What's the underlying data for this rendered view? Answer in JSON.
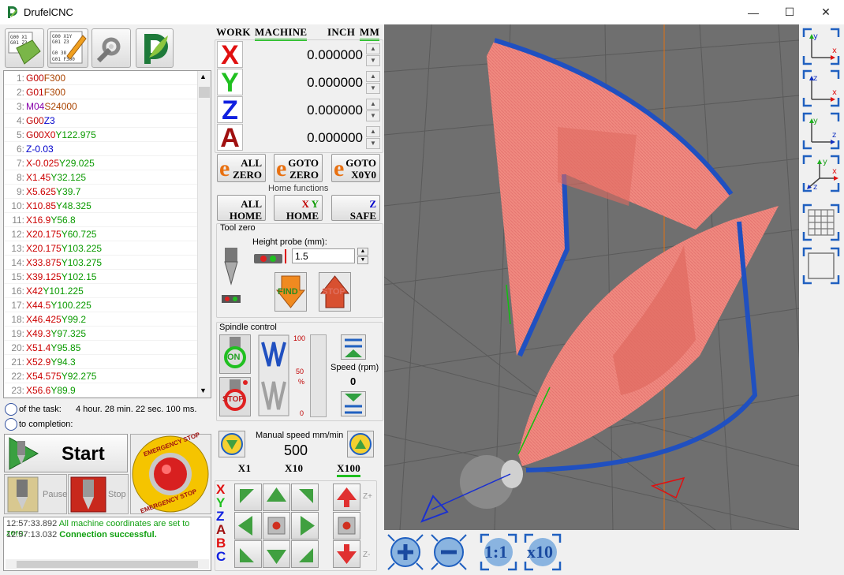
{
  "app": {
    "title": "DrufelCNC"
  },
  "window": {
    "minimize": "—",
    "maximize": "☐",
    "close": "✕"
  },
  "code_lines": [
    {
      "n": "1:",
      "parts": [
        [
          "G00",
          "cg"
        ],
        [
          "F300",
          "cf"
        ]
      ]
    },
    {
      "n": "2:",
      "parts": [
        [
          "G01",
          "cg"
        ],
        [
          "F300",
          "cf"
        ]
      ]
    },
    {
      "n": "3:",
      "parts": [
        [
          "M04",
          "cm"
        ],
        [
          "S24000",
          "cs"
        ]
      ]
    },
    {
      "n": "4:",
      "parts": [
        [
          "G00",
          "cg"
        ],
        [
          "Z3",
          "cz"
        ]
      ]
    },
    {
      "n": "5:",
      "parts": [
        [
          "G00",
          "cg"
        ],
        [
          "X0",
          "cx"
        ],
        [
          "Y122.975",
          "cy"
        ]
      ]
    },
    {
      "n": "6:",
      "parts": [
        [
          "Z-0.03",
          "cz"
        ]
      ]
    },
    {
      "n": "7:",
      "parts": [
        [
          "X-0.025",
          "cx"
        ],
        [
          "Y29.025",
          "cy"
        ]
      ]
    },
    {
      "n": "8:",
      "parts": [
        [
          "X1.45",
          "cx"
        ],
        [
          "Y32.125",
          "cy"
        ]
      ]
    },
    {
      "n": "9:",
      "parts": [
        [
          "X5.625",
          "cx"
        ],
        [
          "Y39.7",
          "cy"
        ]
      ]
    },
    {
      "n": "10:",
      "parts": [
        [
          "X10.85",
          "cx"
        ],
        [
          "Y48.325",
          "cy"
        ]
      ]
    },
    {
      "n": "11:",
      "parts": [
        [
          "X16.9",
          "cx"
        ],
        [
          "Y56.8",
          "cy"
        ]
      ]
    },
    {
      "n": "12:",
      "parts": [
        [
          "X20.175",
          "cx"
        ],
        [
          "Y60.725",
          "cy"
        ]
      ]
    },
    {
      "n": "13:",
      "parts": [
        [
          "X20.175",
          "cx"
        ],
        [
          "Y103.225",
          "cy"
        ]
      ]
    },
    {
      "n": "14:",
      "parts": [
        [
          "X33.875",
          "cx"
        ],
        [
          "Y103.275",
          "cy"
        ]
      ]
    },
    {
      "n": "15:",
      "parts": [
        [
          "X39.125",
          "cx"
        ],
        [
          "Y102.15",
          "cy"
        ]
      ]
    },
    {
      "n": "16:",
      "parts": [
        [
          "X42",
          "cx"
        ],
        [
          "Y101.225",
          "cy"
        ]
      ]
    },
    {
      "n": "17:",
      "parts": [
        [
          "X44.5",
          "cx"
        ],
        [
          "Y100.225",
          "cy"
        ]
      ]
    },
    {
      "n": "18:",
      "parts": [
        [
          "X46.425",
          "cx"
        ],
        [
          "Y99.2",
          "cy"
        ]
      ]
    },
    {
      "n": "19:",
      "parts": [
        [
          "X49.3",
          "cx"
        ],
        [
          "Y97.325",
          "cy"
        ]
      ]
    },
    {
      "n": "20:",
      "parts": [
        [
          "X51.4",
          "cx"
        ],
        [
          "Y95.85",
          "cy"
        ]
      ]
    },
    {
      "n": "21:",
      "parts": [
        [
          "X52.9",
          "cx"
        ],
        [
          "Y94.3",
          "cy"
        ]
      ]
    },
    {
      "n": "22:",
      "parts": [
        [
          "X54.575",
          "cx"
        ],
        [
          "Y92.275",
          "cy"
        ]
      ]
    },
    {
      "n": "23:",
      "parts": [
        [
          "X56.6",
          "cx"
        ],
        [
          "Y89.9",
          "cy"
        ]
      ]
    }
  ],
  "status": {
    "task_label": "of the task:",
    "task_time": "4 hour. 28 min. 22 sec. 100 ms.",
    "completion_label": "to completion:"
  },
  "controls": {
    "start": "Start",
    "pause": "Pause",
    "stop": "Stop",
    "estop_top": "EMERGENCY STOP",
    "estop_bottom": "EMERGENCY STOP"
  },
  "log": [
    {
      "time": "12:57:33.892",
      "msg": "All machine coordinates are set to zero."
    },
    {
      "time": "12:57:13.032",
      "msg": "Connection successful."
    }
  ],
  "coords": {
    "tab_work": "WORK",
    "tab_machine": "MACHINE",
    "unit_inch": "INCH",
    "unit_mm": "MM",
    "axes": [
      {
        "name": "X",
        "value": "0.000000",
        "color": "#e01010"
      },
      {
        "name": "Y",
        "value": "0.000000",
        "color": "#20c020"
      },
      {
        "name": "Z",
        "value": "0.000000",
        "color": "#1020e0"
      },
      {
        "name": "A",
        "value": "0.000000",
        "color": "#a01010"
      }
    ]
  },
  "zero": {
    "all_zero_1": "ALL",
    "all_zero_2": "ZERO",
    "goto_zero_1": "GOTO",
    "goto_zero_2": "ZERO",
    "goto_x0y0_1": "GOTO",
    "goto_x0y0_2": "X0Y0"
  },
  "home": {
    "label": "Home functions",
    "all_home_1": "ALL",
    "all_home_2": "HOME",
    "xy_home_x": "X",
    "xy_home_y": "Y",
    "xy_home_2": "HOME",
    "z_safe_1": "Z",
    "z_safe_2": "SAFE"
  },
  "tool_zero": {
    "label": "Tool zero",
    "probe_label": "Height probe (mm):",
    "probe_value": "1.5",
    "find": "FIND",
    "stop": "STOP"
  },
  "spindle": {
    "label": "Spindle control",
    "on": "ON",
    "stop": "STOP",
    "s100": "100",
    "s50": "50",
    "spct": "%",
    "s0": "0",
    "speed_label": "Speed (rpm)",
    "speed_value": "0"
  },
  "manual": {
    "label": "Manual speed mm/min",
    "value": "500",
    "x1": "X1",
    "x10": "X10",
    "x100": "X100"
  },
  "jog": {
    "axes": [
      "X",
      "Y",
      "Z",
      "A",
      "B",
      "C"
    ],
    "zplus": "Z+",
    "zminus": "Z-"
  },
  "viewport": {
    "zoom_fit": "1:1",
    "zoom_x10": "x10"
  }
}
